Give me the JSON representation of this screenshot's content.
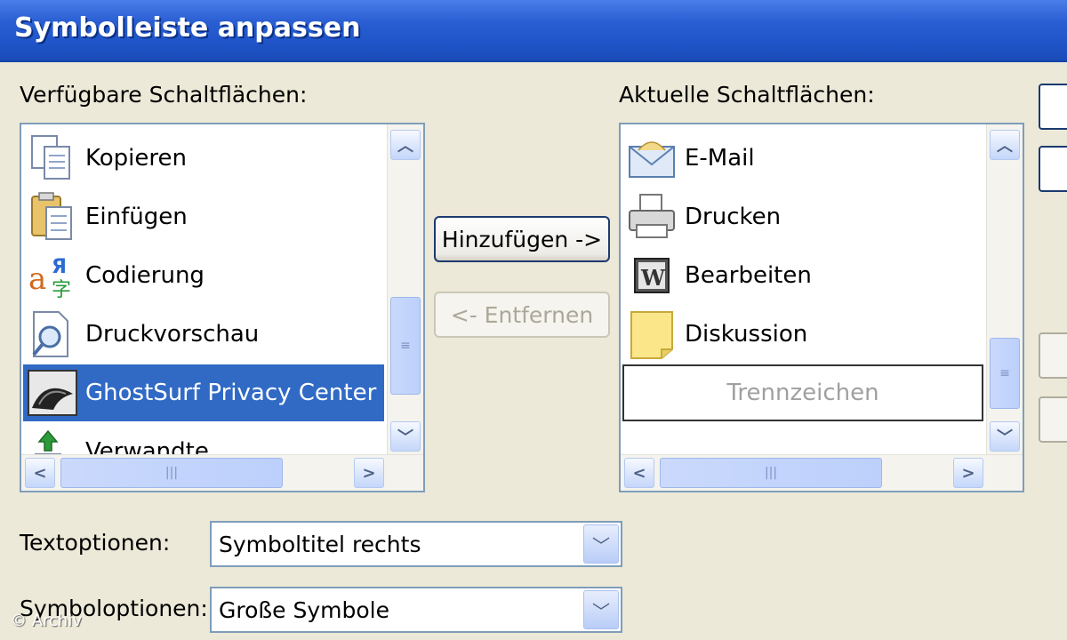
{
  "window": {
    "title": "Symbolleiste anpassen"
  },
  "available": {
    "label": "Verfügbare Schaltflächen:",
    "items": [
      {
        "label": "Kopieren",
        "icon": "copy-icon"
      },
      {
        "label": "Einfügen",
        "icon": "paste-icon"
      },
      {
        "label": "Codierung",
        "icon": "encoding-icon"
      },
      {
        "label": "Druckvorschau",
        "icon": "print-preview-icon"
      },
      {
        "label": "GhostSurf Privacy Center",
        "icon": "ghostsurf-icon",
        "selected": true
      },
      {
        "label": "Verwandte",
        "icon": "related-icon"
      }
    ]
  },
  "current": {
    "label": "Aktuelle Schaltflächen:",
    "items": [
      {
        "label": "E-Mail",
        "icon": "mail-icon"
      },
      {
        "label": "Drucken",
        "icon": "printer-icon"
      },
      {
        "label": "Bearbeiten",
        "icon": "word-edit-icon"
      },
      {
        "label": "Diskussion",
        "icon": "discussion-icon"
      },
      {
        "label": "Trennzeichen",
        "icon": "separator",
        "focused": true
      }
    ]
  },
  "buttons": {
    "add": "Hinzufügen ->",
    "remove": "<- Entfernen"
  },
  "text_options": {
    "label": "Textoptionen:",
    "value": "Symboltitel rechts"
  },
  "icon_options": {
    "label": "Symboloptionen:",
    "value": "Große Symbole"
  },
  "watermark": "© Archiv",
  "colors": {
    "titlebar": "#245edb",
    "selection": "#316ac5",
    "dialog": "#ece9d8"
  }
}
